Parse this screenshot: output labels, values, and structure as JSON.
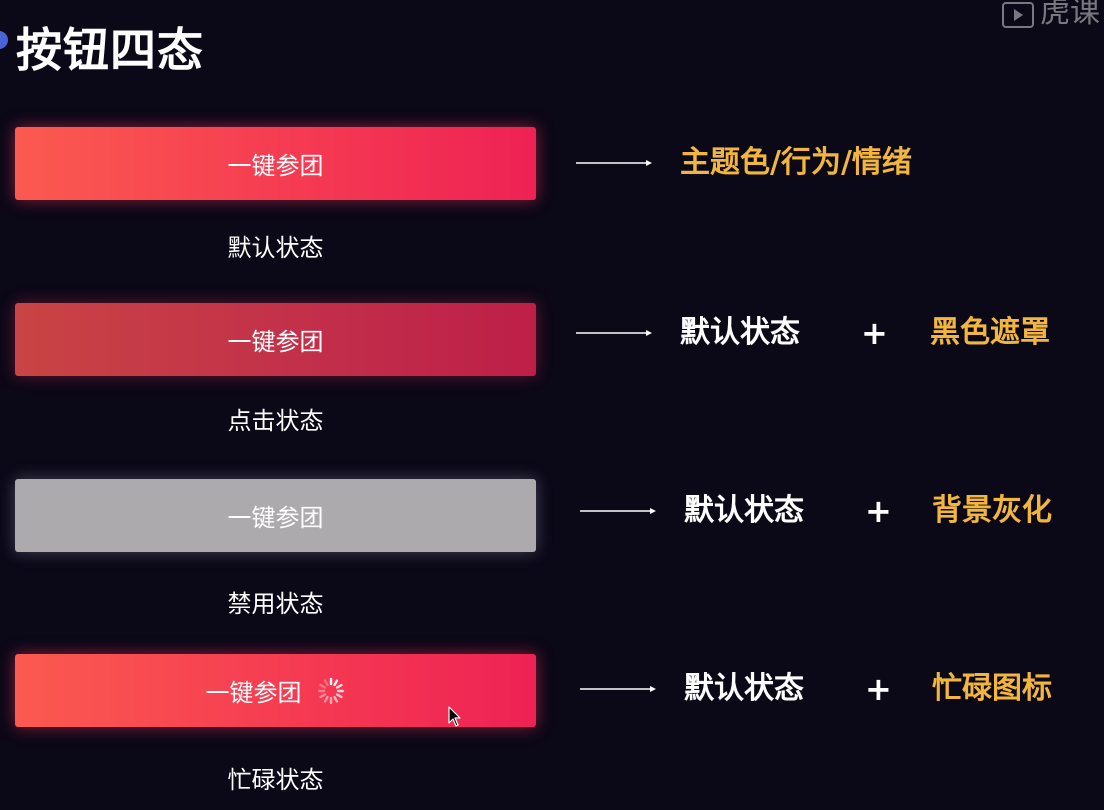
{
  "header": {
    "title": "按钮四态",
    "watermark_text": "虎课"
  },
  "button_label": "一键参团",
  "states": [
    {
      "id": "default",
      "label": "默认状态",
      "description": "主题色/行为/情绪"
    },
    {
      "id": "pressed",
      "label": "点击状态",
      "base": "默认状态",
      "plus": "+",
      "modifier": "黑色遮罩"
    },
    {
      "id": "disabled",
      "label": "禁用状态",
      "base": "默认状态",
      "plus": "+",
      "modifier": "背景灰化"
    },
    {
      "id": "loading",
      "label": "忙碌状态",
      "base": "默认状态",
      "plus": "+",
      "modifier": "忙碌图标"
    }
  ],
  "colors": {
    "background": "#0b0818",
    "accent_yellow": "#f2b63c",
    "button_default_start": "#fb5a50",
    "button_default_end": "#ee2254",
    "button_pressed": "#c2304a",
    "button_disabled": "#acaaad"
  },
  "icons": [
    "arrow-right-icon",
    "loading-spinner-icon",
    "mouse-cursor-icon",
    "play-logo-icon"
  ]
}
